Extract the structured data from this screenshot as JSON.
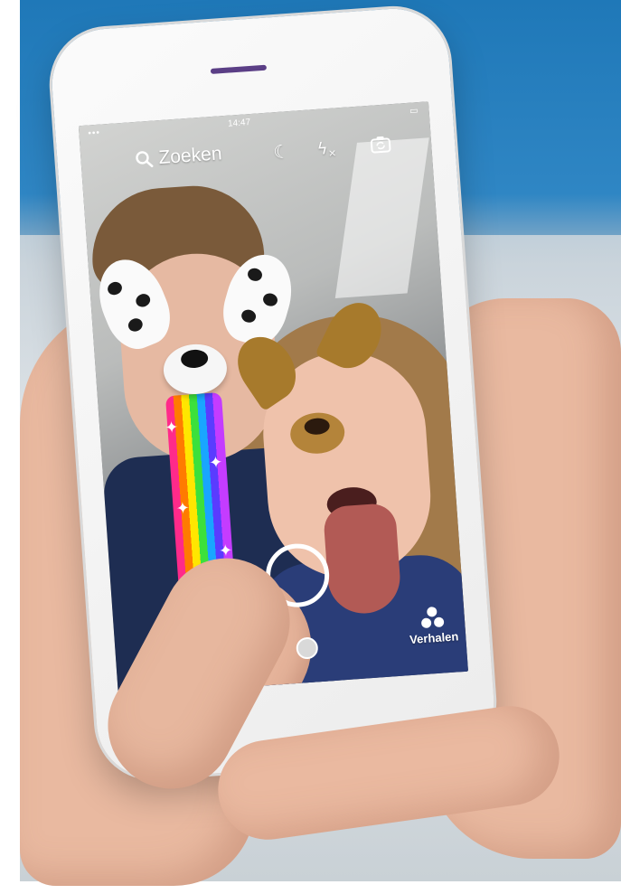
{
  "status_bar": {
    "time": "14:47",
    "signal": "•••",
    "battery": "▭"
  },
  "camera": {
    "search_label": "Zoeken",
    "stories_label": "Verhalen"
  },
  "icons": {
    "search": "search-icon",
    "night_mode": "moon-icon",
    "flash": "flash-off-icon",
    "flip_camera": "flip-camera-icon",
    "stories": "stories-icon",
    "capture": "shutter-button"
  }
}
